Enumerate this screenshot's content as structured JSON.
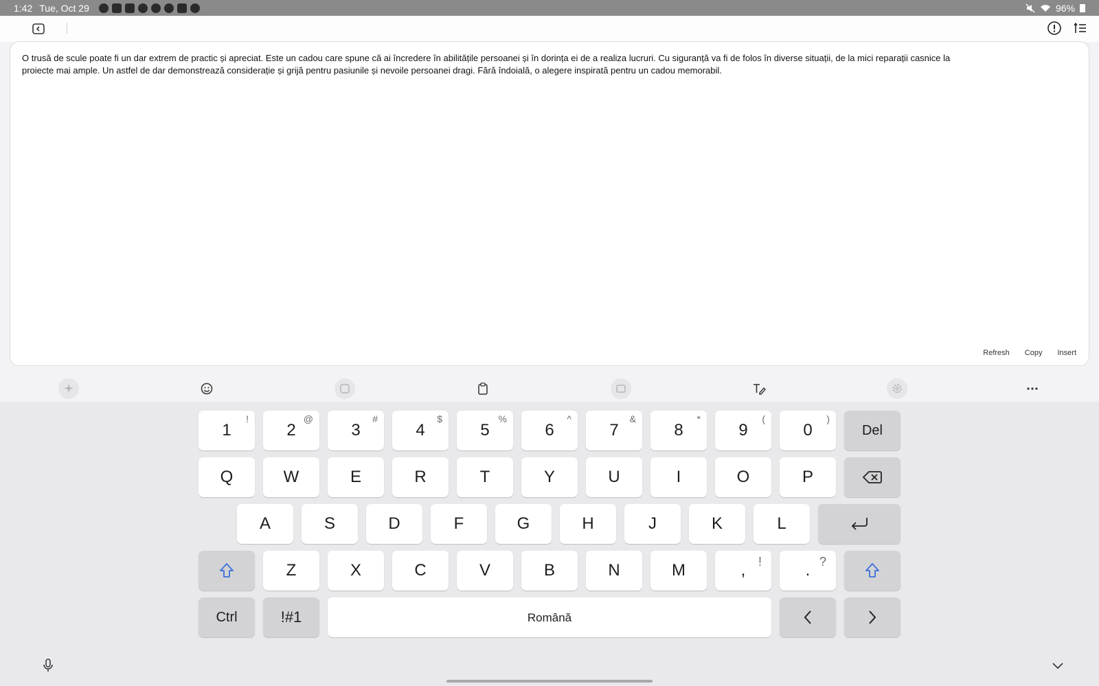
{
  "status_bar": {
    "time": "1:42",
    "date": "Tue, Oct 29",
    "battery": "96%",
    "notification_icons": [
      "messenger-icon",
      "gmail-icon",
      "skype-icon",
      "fan-icon",
      "camera-app-icon",
      "record-icon",
      "gallery-icon",
      "settings-icon"
    ]
  },
  "text_panel": {
    "text": "O trusă de scule poate fi un dar extrem de practic și apreciat.  Este un cadou care spune că ai încredere în abilitățile persoanei și în dorința ei de a realiza lucruri. Cu siguranță va fi de folos în diverse situații, de la mici reparații casnice la proiecte mai ample.  Un astfel de dar demonstrează considerație și grijă pentru pasiunile și nevoile persoanei dragi.  Fără îndoială, o alegere inspirată pentru un cadou memorabil.",
    "actions": {
      "refresh": "Refresh",
      "copy": "Copy",
      "insert": "Insert"
    }
  },
  "keyboard": {
    "number_row": [
      {
        "main": "1",
        "sym": "!"
      },
      {
        "main": "2",
        "sym": "@"
      },
      {
        "main": "3",
        "sym": "#"
      },
      {
        "main": "4",
        "sym": "$"
      },
      {
        "main": "5",
        "sym": "%"
      },
      {
        "main": "6",
        "sym": "^"
      },
      {
        "main": "7",
        "sym": "&"
      },
      {
        "main": "8",
        "sym": "*"
      },
      {
        "main": "9",
        "sym": "("
      },
      {
        "main": "0",
        "sym": ")"
      }
    ],
    "del_label": "Del",
    "row_q": [
      "Q",
      "W",
      "E",
      "R",
      "T",
      "Y",
      "U",
      "I",
      "O",
      "P"
    ],
    "row_a": [
      "A",
      "S",
      "D",
      "F",
      "G",
      "H",
      "J",
      "K",
      "L"
    ],
    "row_z": [
      "Z",
      "X",
      "C",
      "V",
      "B",
      "N",
      "M"
    ],
    "comma": {
      "main": ",",
      "sym": "!"
    },
    "period": {
      "main": ".",
      "sym": "?"
    },
    "ctrl_label": "Ctrl",
    "symbols_label": "!#1",
    "space_label": "Română",
    "accent_color": "#3d6fd9"
  }
}
